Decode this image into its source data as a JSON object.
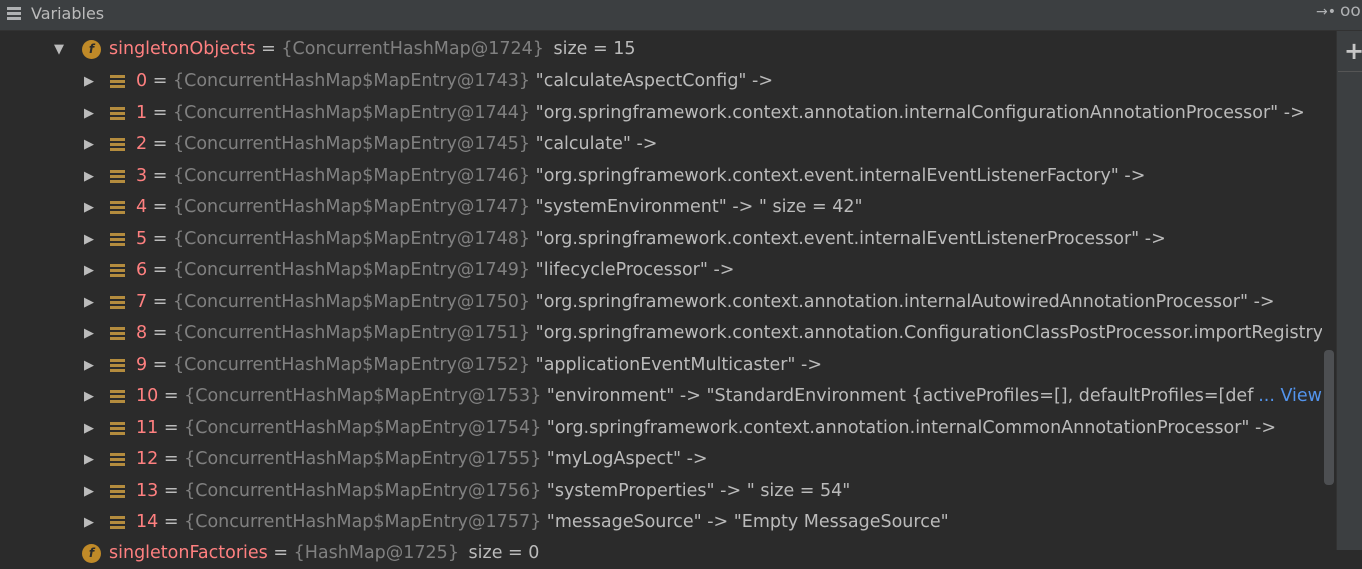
{
  "header": {
    "title": "Variables"
  },
  "icons": {
    "menu": "hamburger-icon",
    "pin": "restore-layout-icon",
    "watch": "glasses-icon",
    "add": "plus-icon"
  },
  "root": {
    "name": "singletonObjects",
    "equals": "=",
    "ref": "{ConcurrentHashMap@1724}",
    "size": "size = 15"
  },
  "entries": [
    {
      "index": "0",
      "ref": "{ConcurrentHashMap$MapEntry@1743}",
      "value": "\"calculateAspectConfig\" ->"
    },
    {
      "index": "1",
      "ref": "{ConcurrentHashMap$MapEntry@1744}",
      "value": "\"org.springframework.context.annotation.internalConfigurationAnnotationProcessor\" ->"
    },
    {
      "index": "2",
      "ref": "{ConcurrentHashMap$MapEntry@1745}",
      "value": "\"calculate\" ->"
    },
    {
      "index": "3",
      "ref": "{ConcurrentHashMap$MapEntry@1746}",
      "value": "\"org.springframework.context.event.internalEventListenerFactory\" ->"
    },
    {
      "index": "4",
      "ref": "{ConcurrentHashMap$MapEntry@1747}",
      "value": "\"systemEnvironment\" -> \" size = 42\""
    },
    {
      "index": "5",
      "ref": "{ConcurrentHashMap$MapEntry@1748}",
      "value": "\"org.springframework.context.event.internalEventListenerProcessor\" ->"
    },
    {
      "index": "6",
      "ref": "{ConcurrentHashMap$MapEntry@1749}",
      "value": "\"lifecycleProcessor\" ->"
    },
    {
      "index": "7",
      "ref": "{ConcurrentHashMap$MapEntry@1750}",
      "value": "\"org.springframework.context.annotation.internalAutowiredAnnotationProcessor\" ->"
    },
    {
      "index": "8",
      "ref": "{ConcurrentHashMap$MapEntry@1751}",
      "value": "\"org.springframework.context.annotation.ConfigurationClassPostProcessor.importRegistry\" ->"
    },
    {
      "index": "9",
      "ref": "{ConcurrentHashMap$MapEntry@1752}",
      "value": "\"applicationEventMulticaster\" ->"
    },
    {
      "index": "10",
      "ref": "{ConcurrentHashMap$MapEntry@1753}",
      "value": "\"environment\" -> \"StandardEnvironment {activeProfiles=[], defaultProfiles=[default], p",
      "view_link": "... View"
    },
    {
      "index": "11",
      "ref": "{ConcurrentHashMap$MapEntry@1754}",
      "value": "\"org.springframework.context.annotation.internalCommonAnnotationProcessor\" ->"
    },
    {
      "index": "12",
      "ref": "{ConcurrentHashMap$MapEntry@1755}",
      "value": "\"myLogAspect\" ->"
    },
    {
      "index": "13",
      "ref": "{ConcurrentHashMap$MapEntry@1756}",
      "value": "\"systemProperties\" -> \" size = 54\""
    },
    {
      "index": "14",
      "ref": "{ConcurrentHashMap$MapEntry@1757}",
      "value": "\"messageSource\" -> \"Empty MessageSource\""
    }
  ],
  "next_root": {
    "name": "singletonFactories",
    "equals": "=",
    "ref": "{HashMap@1725}",
    "size": "size = 0"
  },
  "equals": "="
}
